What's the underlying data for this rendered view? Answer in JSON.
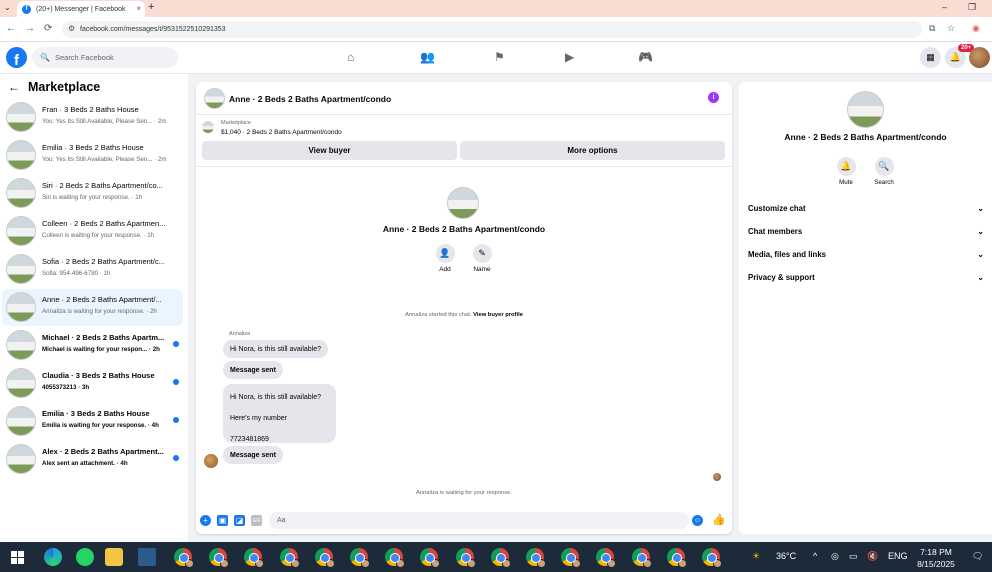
{
  "browser": {
    "tab_title": "(20+) Messenger | Facebook",
    "url": "facebook.com/messages/t/9531522510291353"
  },
  "fb": {
    "search_placeholder": "Search Facebook",
    "notification_badge": "20+"
  },
  "sidebar": {
    "title": "Marketplace",
    "conversations": [
      {
        "name": "Fran · 3 Beds 2 Baths House",
        "preview": "You: Yes Its Still Available, Please Sen... · 2m",
        "unread": false,
        "active": false
      },
      {
        "name": "Emilia · 3 Beds 2 Baths House",
        "preview": "You: Yes Its Still Available, Please Sen... · 2m",
        "unread": false,
        "active": false
      },
      {
        "name": "Siri · 2 Beds 2 Baths Apartment/co...",
        "preview": "Siri is waiting for your response. · 1h",
        "unread": false,
        "active": false
      },
      {
        "name": "Colleen · 2 Beds 2 Baths Apartmen...",
        "preview": "Colleen is waiting for your response. · 1h",
        "unread": false,
        "active": false
      },
      {
        "name": "Sofia · 2 Beds 2 Baths Apartment/c...",
        "preview": "Sofia: 954-496-6780 · 1h",
        "unread": false,
        "active": false
      },
      {
        "name": "Anne · 2 Beds 2 Baths Apartment/...",
        "preview": "Annaliza is waiting for your response. · 2h",
        "unread": false,
        "active": true
      },
      {
        "name": "Michael · 2 Beds 2 Baths Apartm...",
        "preview": "Michael is waiting for your respon... · 2h",
        "unread": true,
        "active": false
      },
      {
        "name": "Claudia · 3 Beds 2 Baths House",
        "preview": "4055373213 · 3h",
        "unread": true,
        "active": false
      },
      {
        "name": "Emilia · 3 Beds 2 Baths House",
        "preview": "Emilia is waiting for your response. · 4h",
        "unread": true,
        "active": false
      },
      {
        "name": "Alex · 2 Beds 2 Baths Apartment...",
        "preview": "Alex sent an attachment. · 4h",
        "unread": true,
        "active": false
      }
    ]
  },
  "chat": {
    "title": "Anne · 2 Beds 2 Baths Apartment/condo",
    "marketplace_label": "Marketplace",
    "listing": "$1,040 · 2 Beds 2 Baths Apartment/condo",
    "view_buyer": "View buyer",
    "more_options": "More options",
    "center_title": "Anne · 2 Beds 2 Baths Apartment/condo",
    "add_label": "Add",
    "name_label": "Name",
    "system_msg": "Annaliza started this chat.",
    "system_link": "View buyer profile",
    "sender": "Annaliza",
    "msg1": "Hi Nora, is this still available?",
    "msg2": "Message sent",
    "msg3_lines": [
      "Hi Nora, is this still available?",
      "Here's my number",
      "7723481869"
    ],
    "msg4": "Message sent",
    "waiting": "Annaliza is waiting for your response.",
    "input_placeholder": "Aa"
  },
  "info_panel": {
    "title": "Anne · 2 Beds 2 Baths Apartment/condo",
    "mute": "Mute",
    "search": "Search",
    "rows": [
      "Customize chat",
      "Chat members",
      "Media, files and links",
      "Privacy & support"
    ]
  },
  "taskbar": {
    "weather": "36°C",
    "lang": "ENG",
    "time": "7:18 PM",
    "date": "8/15/2025"
  }
}
